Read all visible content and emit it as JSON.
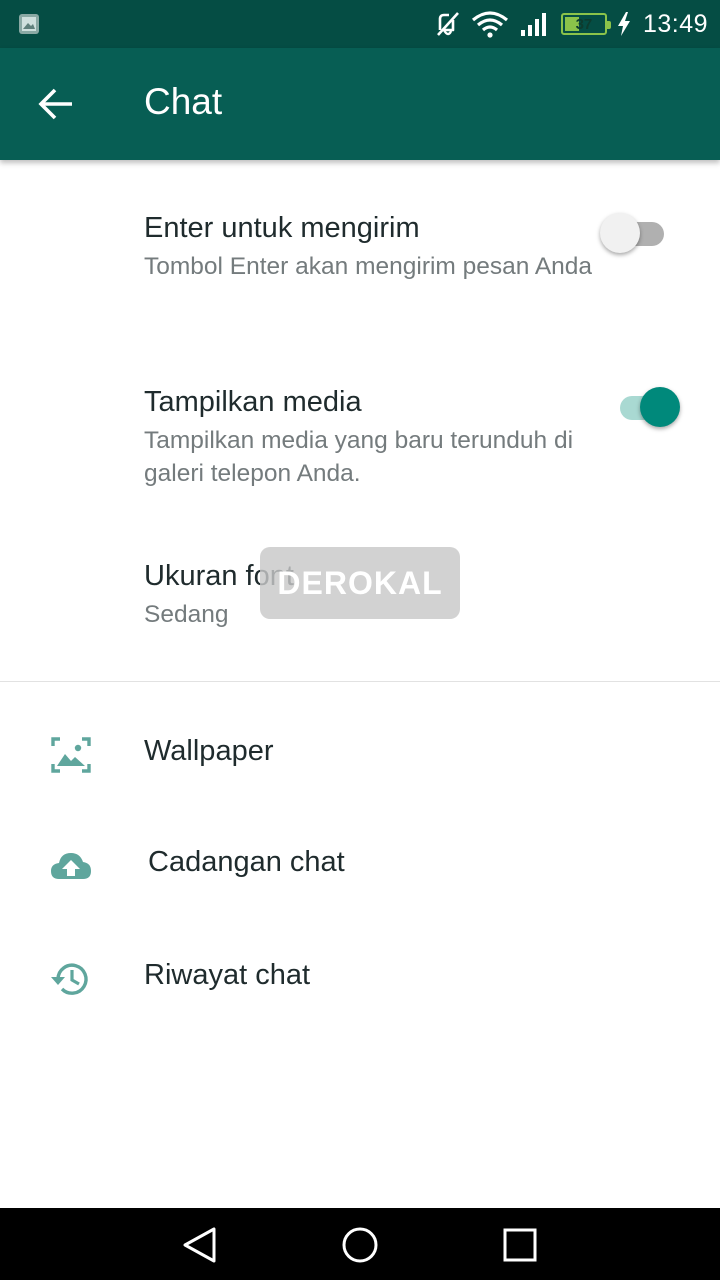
{
  "status_bar": {
    "time": "13:49",
    "battery_level": "37",
    "battery_fraction": 0.37,
    "icons": [
      "gallery-notification-icon",
      "vibrate-off-icon",
      "wifi-icon",
      "signal-icon",
      "battery-icon",
      "charging-icon"
    ]
  },
  "app_bar": {
    "title": "Chat",
    "back_icon": "arrow-left-icon"
  },
  "settings": {
    "enter_to_send": {
      "label": "Enter untuk mengirim",
      "description": "Tombol Enter akan mengirim pesan Anda",
      "enabled": false
    },
    "show_media": {
      "label": "Tampilkan media",
      "description": "Tampilkan media yang baru terunduh di galeri telepon Anda.",
      "enabled": true
    },
    "font_size": {
      "label": "Ukuran font",
      "value": "Sedang"
    }
  },
  "menu_items": [
    {
      "label": "Wallpaper",
      "icon": "wallpaper-icon"
    },
    {
      "label": "Cadangan chat",
      "icon": "cloud-upload-icon"
    },
    {
      "label": "Riwayat chat",
      "icon": "history-icon"
    }
  ],
  "watermark": {
    "text": "DEROKAL"
  },
  "colors": {
    "status_bar": "#054d44",
    "app_bar": "#075e54",
    "accent": "#00897b",
    "icon_tint": "#5fa69d",
    "battery": "#8bc34a"
  },
  "nav_bar": {
    "icons": [
      "back-triangle-icon",
      "home-circle-icon",
      "recents-square-icon"
    ]
  }
}
